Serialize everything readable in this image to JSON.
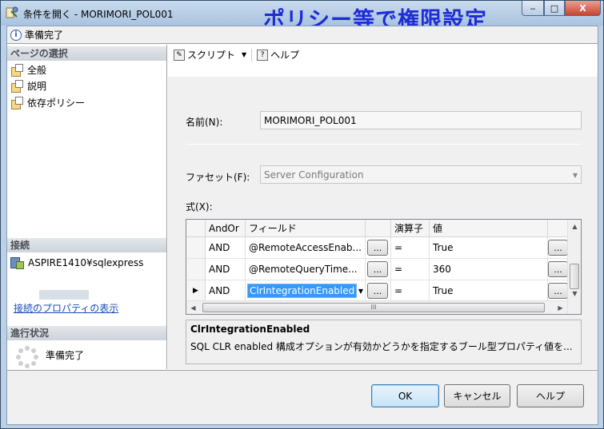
{
  "window": {
    "title": "条件を開く - MORIMORI_POL001",
    "overlay_caption": "ポリシー等で権限設定",
    "min_label": "‒",
    "max_label": "□",
    "close_label": "X"
  },
  "status": {
    "text": "準備完了"
  },
  "left": {
    "page_select_header": "ページの選択",
    "pages": [
      "全般",
      "説明",
      "依存ポリシー"
    ],
    "connection_header": "接続",
    "server": "ASPIRE1410¥sqlexpress",
    "connection_link": "接続のプロパティの表示",
    "progress_header": "進行状況",
    "progress_status": "準備完了"
  },
  "toolbar": {
    "script_label": "スクリプト",
    "help_label": "ヘルプ"
  },
  "form": {
    "name_label": "名前(N):",
    "name_value": "MORIMORI_POL001",
    "facet_label": "ファセット(F):",
    "facet_value": "Server Configuration",
    "expression_label": "式(X):"
  },
  "grid": {
    "headers": [
      "AndOr",
      "フィールド",
      "",
      "演算子",
      "値"
    ],
    "rows": [
      {
        "andor": "AND",
        "field": "@RemoteAccessEnab...",
        "btn": "...",
        "op": "=",
        "value": "True",
        "btn2": "..."
      },
      {
        "andor": "AND",
        "field": "@RemoteQueryTime...",
        "btn": "...",
        "op": "=",
        "value": "360",
        "btn2": "..."
      },
      {
        "andor": "AND",
        "field": "ClrIntegrationEnabled",
        "btn": "...",
        "op": "=",
        "value": "True",
        "btn2": "...",
        "selected": true
      }
    ],
    "scroll_up": "▲",
    "scroll_down": "▼",
    "scroll_left": "◀",
    "scroll_right": "▶",
    "hthumb_grip": "III"
  },
  "description": {
    "title": "ClrIntegrationEnabled",
    "text": "SQL CLR enabled 構成オプションが有効かどうかを指定するブール型プロパティ値を..."
  },
  "buttons": {
    "ok": "OK",
    "cancel": "キャンセル",
    "help": "ヘルプ"
  }
}
